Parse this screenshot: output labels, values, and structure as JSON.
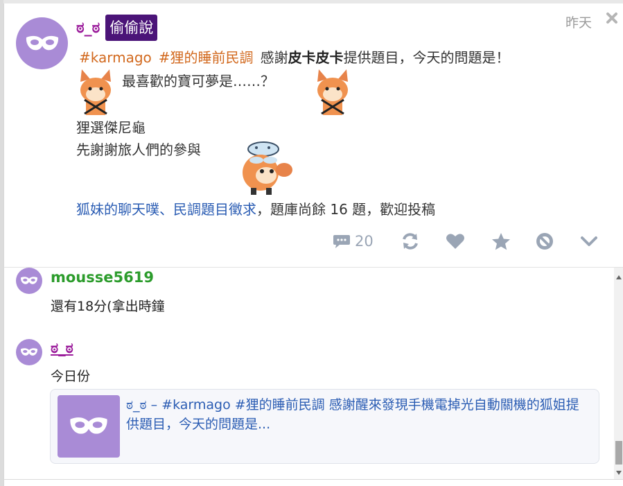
{
  "post": {
    "author": "ಠ_ಠ",
    "qualifier": "偷偷說",
    "time": "昨天",
    "tags": [
      "#karmago",
      "#狸的睡前民調"
    ],
    "intro_before": "感謝",
    "intro_strong": "皮卡皮卡",
    "intro_after": "提供題目，今天的問題是！",
    "question": "最喜歡的寶可夢是……？",
    "answer": "狸選傑尼龜",
    "thanks": "先謝謝旅人們的參與",
    "link1": "狐妹的聊天噗",
    "separator": "、",
    "link2": "民調題目徵求",
    "footer_rest": "，題庫尚餘 16 題，歡迎投稿"
  },
  "actions": {
    "response_count": "20",
    "icons": [
      "speech-bubble-icon",
      "replurk-icon",
      "heart-icon",
      "star-icon",
      "mute-icon",
      "chevron-down-icon"
    ]
  },
  "responses": [
    {
      "name": "mousse5619",
      "name_color": "#2c9c2c",
      "text": "還有18分(拿出時鐘"
    },
    {
      "name": "ಠ_ಠ",
      "name_color": "#9b1c9b",
      "text": "今日份"
    }
  ],
  "quote": {
    "text": "ಠ_ಠ – #karmago #狸的睡前民調 感謝醒來發現手機電掉光自動關機的狐姐提供題目，今天的問題是..."
  },
  "colors": {
    "accent_purple": "#4b1478",
    "avatar_lilac": "#a98bd6",
    "tag_orange": "#d2691e",
    "link_blue": "#2a5cb3"
  }
}
